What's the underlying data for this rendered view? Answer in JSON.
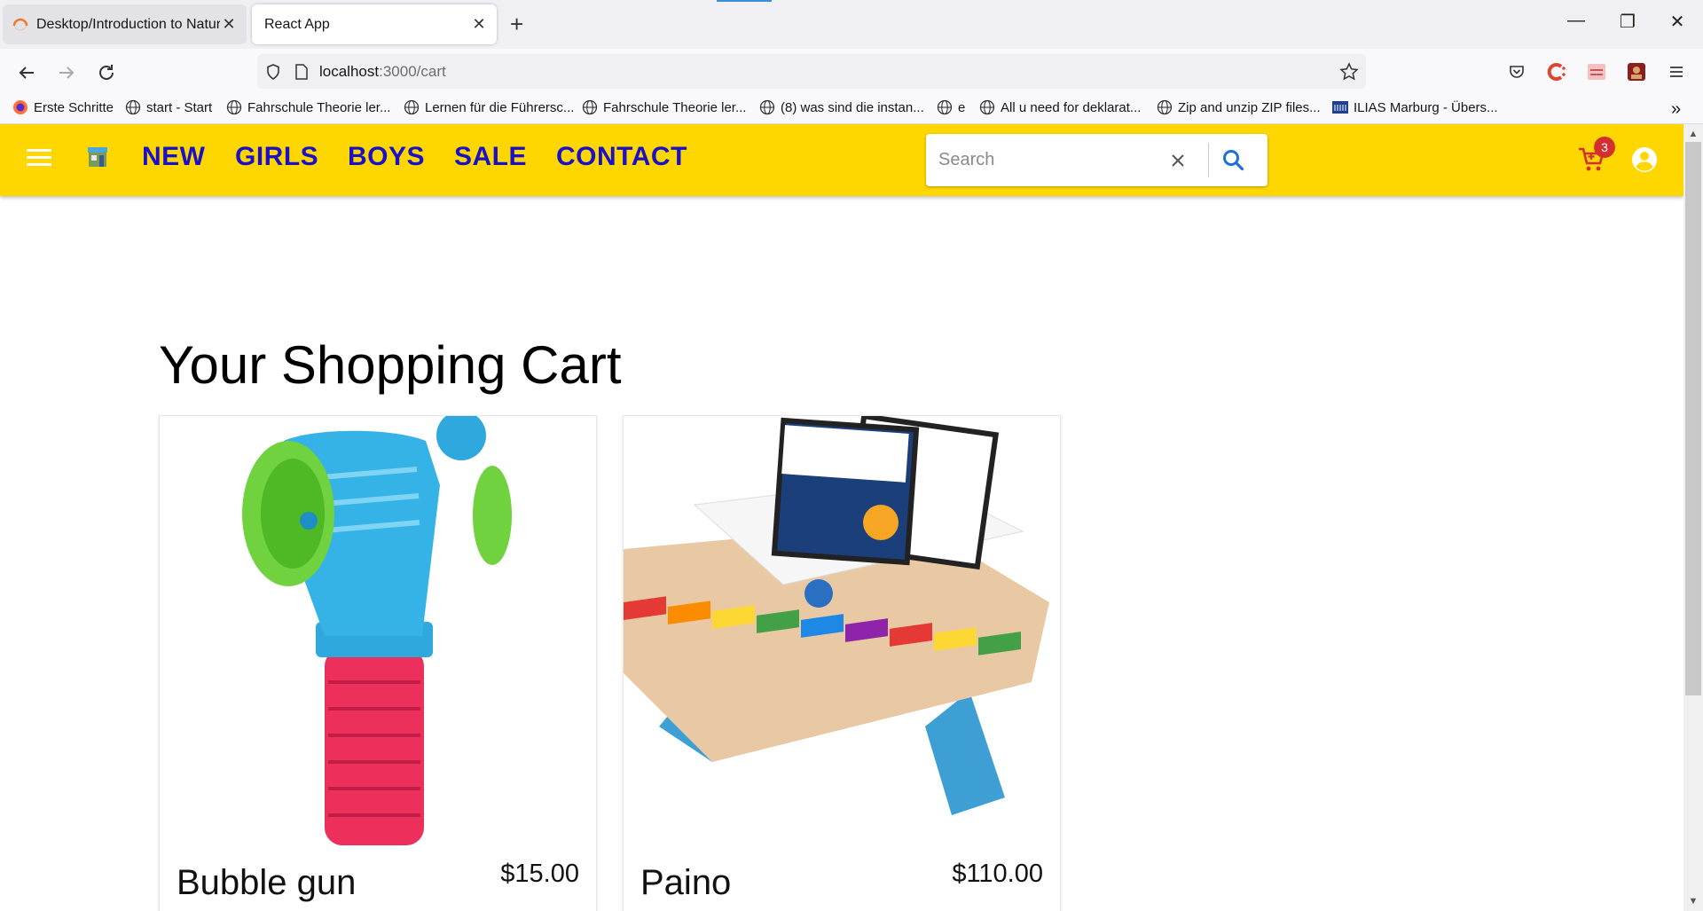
{
  "browser": {
    "tabs": [
      {
        "title": "Desktop/Introduction to Natur",
        "active": false
      },
      {
        "title": "React App",
        "active": true
      }
    ],
    "url": {
      "host": "localhost",
      "path": ":3000/cart"
    },
    "bookmarks": [
      "Erste Schritte",
      "start - Start",
      "Fahrschule Theorie ler...",
      "Lernen für die Führersc...",
      "Fahrschule Theorie ler...",
      "(8) was sind die instan...",
      "e",
      "All u need for deklarat...",
      "Zip and unzip ZIP files...",
      "ILIAS Marburg - Übers..."
    ]
  },
  "app": {
    "nav": [
      "NEW",
      "GIRLS",
      "BOYS",
      "SALE",
      "CONTACT"
    ],
    "search_placeholder": "Search",
    "cart_count": "3",
    "colors": {
      "bar": "#ffd700",
      "link": "#1a10c8",
      "badge": "#d32f2f",
      "icon": "#1e6fd9"
    }
  },
  "cart": {
    "heading": "Your Shopping Cart",
    "items": [
      {
        "name": "Bubble gun",
        "price": "$15.00"
      },
      {
        "name": "Paino",
        "price": "$110.00"
      }
    ]
  }
}
